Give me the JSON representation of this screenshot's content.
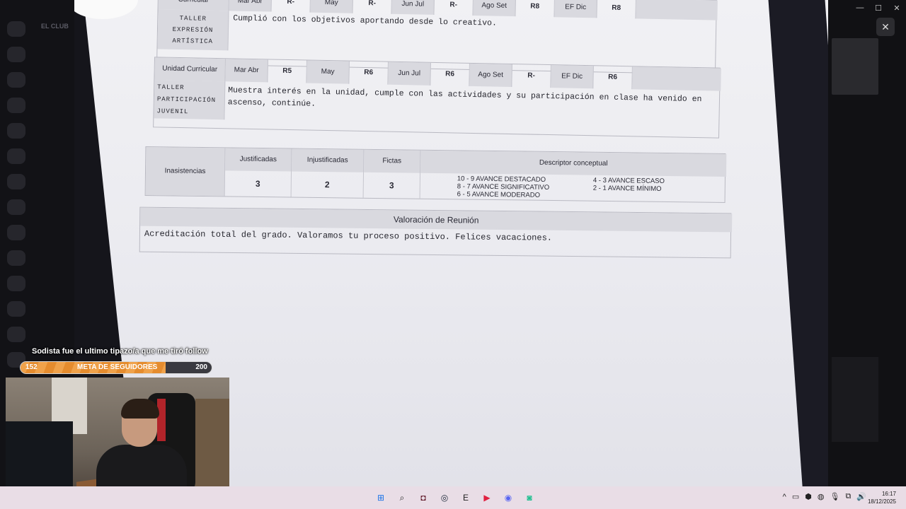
{
  "background_app": {
    "server_name": "EL CLUB"
  },
  "document": {
    "table_top": {
      "label": "Curricular",
      "subject": "TALLER EXPRESIÓN ARTÍSTICA",
      "comment": "Cumplió con los objetivos aportando desde lo creativo.",
      "months": [
        "Mar Abr",
        "May",
        "Jun Jul",
        "Ago Set",
        "EF Dic"
      ],
      "grades": [
        "-",
        "-",
        "-",
        "8",
        "8"
      ],
      "r": "R"
    },
    "table_mid": {
      "label": "Unidad Curricular",
      "subject_lines": [
        "TALLER",
        "PARTICIPACIÓN",
        "JUVENIL"
      ],
      "comment": "Muestra interés en la unidad, cumple con las actividades y su participación en clase ha venido en ascenso, continúe.",
      "months": [
        "Mar Abr",
        "May",
        "Jun Jul",
        "Ago Set",
        "EF Dic"
      ],
      "grades": [
        "5",
        "6",
        "6",
        "-",
        "6"
      ],
      "r": "R"
    },
    "absences": {
      "label": "Inasistencias",
      "headers": [
        "Justificadas",
        "Injustificadas",
        "Fictas"
      ],
      "values": [
        "3",
        "2",
        "3"
      ],
      "descriptor_title": "Descriptor conceptual",
      "descriptors_left": [
        "10 - 9   AVANCE DESTACADO",
        "8 - 7   AVANCE SIGNIFICATIVO",
        "6 - 5   AVANCE MODERADO"
      ],
      "descriptors_right": [
        "4 - 3   AVANCE ESCASO",
        "2 - 1   AVANCE MÍNIMO"
      ]
    },
    "meeting": {
      "title": "Valoración de Reunión",
      "text": "Acreditación total del grado. Valoramos tu proceso positivo. Felices vacaciones."
    }
  },
  "overlay": {
    "follow_text": "Sodista fue el ultimo tipazo/a que me tiró follow",
    "goal_label": "META DE SEGUIDORES",
    "goal_current": "152",
    "goal_target": "200",
    "goal_progress": 0.76
  },
  "window_controls": {
    "minimize": "—",
    "maximize": "☐",
    "close": "✕"
  },
  "close_button": "✕",
  "taskbar": {
    "apps": [
      {
        "name": "start",
        "glyph": "⊞",
        "color": "#1a73e8"
      },
      {
        "name": "search",
        "glyph": "⌕",
        "color": "#222222"
      },
      {
        "name": "app-dark",
        "glyph": "◘",
        "color": "#5a1020"
      },
      {
        "name": "steam",
        "glyph": "◎",
        "color": "#1b2838"
      },
      {
        "name": "epic",
        "glyph": "E",
        "color": "#222222"
      },
      {
        "name": "media",
        "glyph": "▶",
        "color": "#e02040"
      },
      {
        "name": "discord",
        "glyph": "◉",
        "color": "#5865f2"
      },
      {
        "name": "bot",
        "glyph": "◙",
        "color": "#1fbf8f"
      }
    ],
    "tray": [
      "^",
      "▭",
      "⬢",
      "◍",
      "🎙",
      "⧉",
      "🔊"
    ],
    "time": "16:17",
    "date": "18/12/2025"
  }
}
